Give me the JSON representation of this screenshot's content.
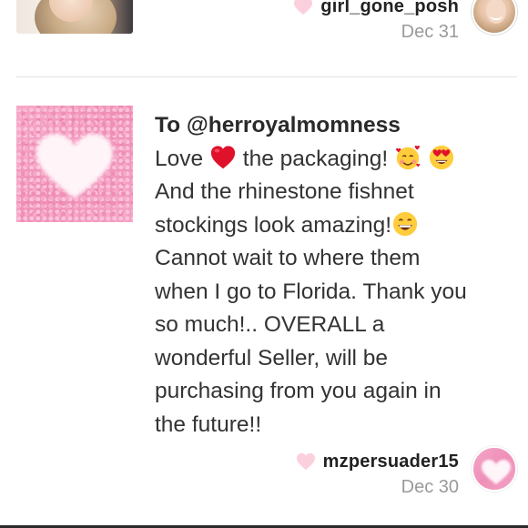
{
  "previous_review": {
    "username": "girl_gone_posh",
    "date": "Dec 31"
  },
  "review": {
    "recipient": "To @herroyalmomness",
    "text_line1_a": "Love",
    "text_line1_b": "the packaging!",
    "text_line2": "And the rhinestone fishnet",
    "text_line3": "stockings look amazing!",
    "text_line4": "Cannot wait to where them",
    "text_line5": "when I go to Florida. Thank you",
    "text_line6": "so much!.. OVERALL a",
    "text_line7": "wonderful Seller, will be",
    "text_line8": "purchasing from you again in",
    "text_line9": "the future!!",
    "username": "mzpersuader15",
    "date": "Dec 30"
  },
  "icons": {
    "like": "heart-icon",
    "emoji_love": "red-heart-emoji",
    "emoji_hearts_face": "smiling-face-with-hearts-emoji",
    "emoji_heart_eyes": "heart-eyes-emoji",
    "emoji_grin": "grinning-face-emoji"
  },
  "colors": {
    "heart_pink": "#fbd0dc",
    "date_gray": "#9a9a9a",
    "divider": "#e2e2e2"
  }
}
